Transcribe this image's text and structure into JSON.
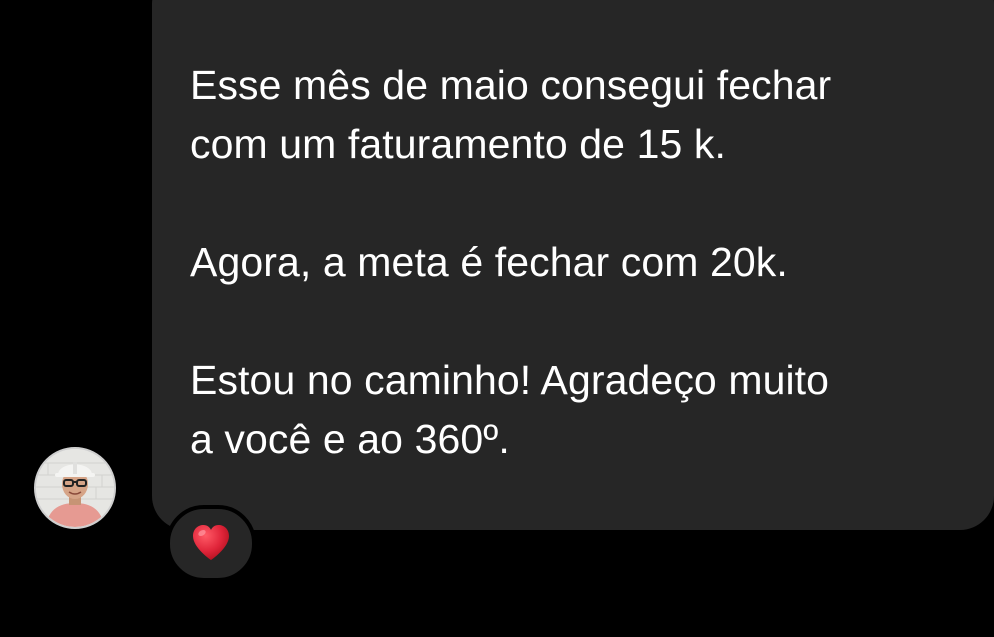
{
  "message": {
    "paragraphs": [
      "Esse mês de maio consegui fechar\ncom um faturamento de 15 k.",
      "Agora, a meta é fechar com 20k.",
      "Estou no caminho! Agradeço muito\na você e ao 360º."
    ],
    "reaction_icon": "red-heart-icon"
  },
  "sender": {
    "avatar_icon": "profile-photo"
  },
  "colors": {
    "background": "#000000",
    "bubble": "#262626",
    "text": "#ffffff",
    "heart": "#e0253a"
  }
}
